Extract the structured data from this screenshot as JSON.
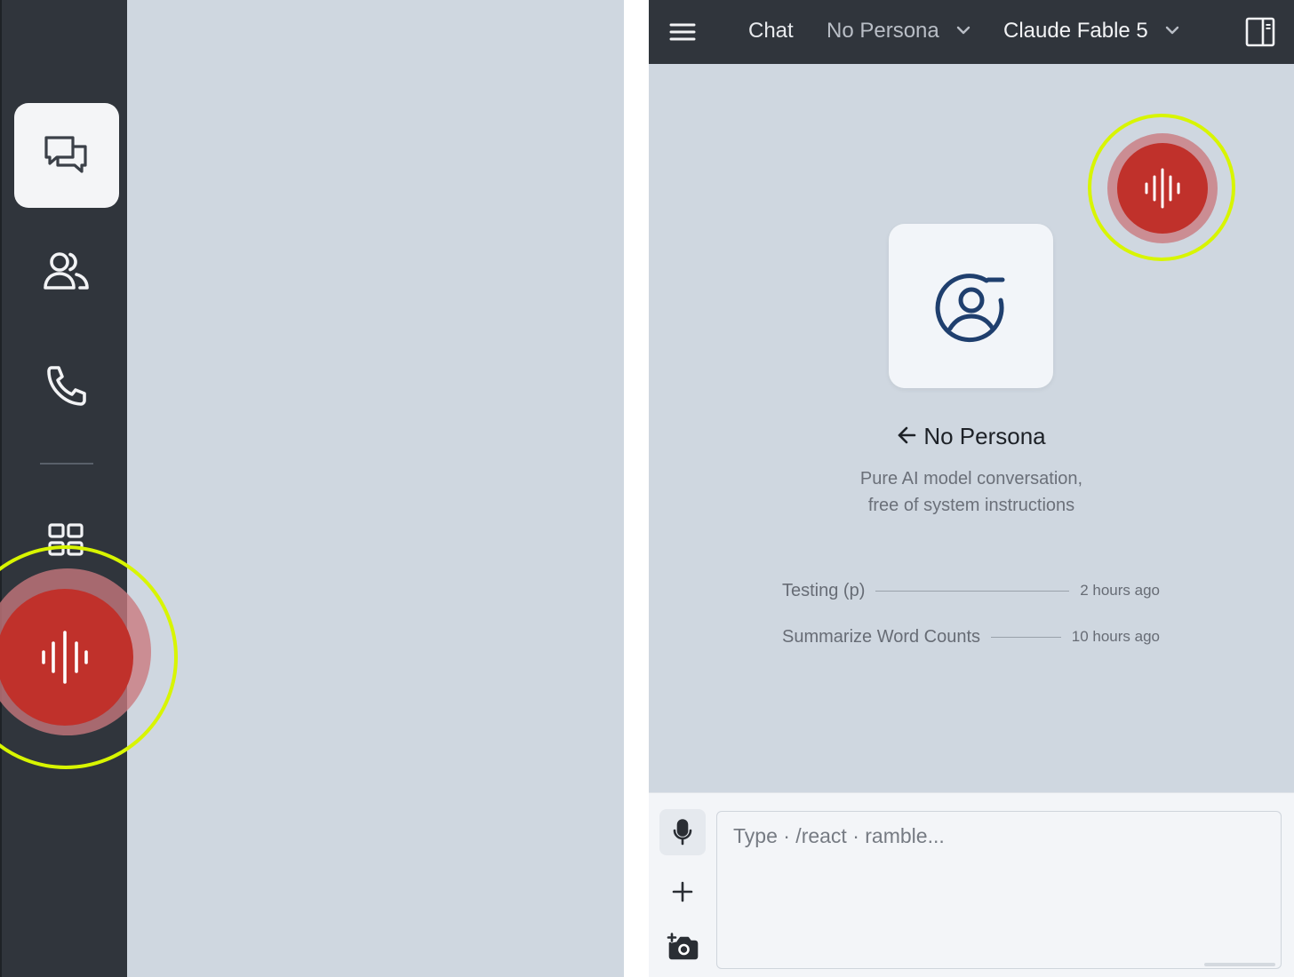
{
  "sidebar": {
    "items": [
      {
        "icon": "chat-bubbles-icon",
        "active": true
      },
      {
        "icon": "users-icon",
        "active": false
      },
      {
        "icon": "phone-icon",
        "active": false
      },
      {
        "icon": "grid-icon",
        "active": false
      }
    ]
  },
  "record_button": {
    "icon": "audio-waveform-icon",
    "color": "#c0312b",
    "highlight_ring_color": "#d8f500"
  },
  "header": {
    "chat_label": "Chat",
    "persona_label": "No Persona",
    "model_label": "Claude Fable 5"
  },
  "persona": {
    "title": "No Persona",
    "description_line1": "Pure AI model conversation,",
    "description_line2": "free of system instructions"
  },
  "history": [
    {
      "title": "Testing (p)",
      "time": "2 hours ago"
    },
    {
      "title": "Summarize Word Counts",
      "time": "10 hours ago"
    }
  ],
  "composer": {
    "placeholder": "Type · /react · ramble..."
  },
  "colors": {
    "rail": "#30353c",
    "background": "#cfd7e0",
    "accent_icon": "#1f3f6e"
  }
}
